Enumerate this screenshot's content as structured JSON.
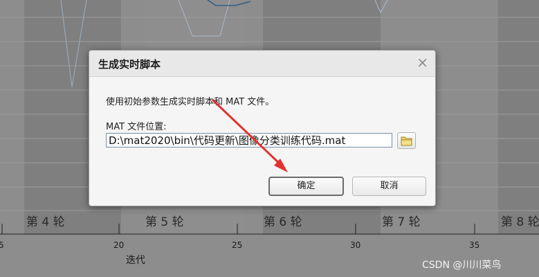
{
  "background_chart": {
    "epoch_labels": [
      "第 4 轮",
      "第 5 轮",
      "第 6 轮",
      "第 7 轮",
      "第 8 轮"
    ],
    "x_ticks": [
      "5",
      "20",
      "25",
      "30",
      "35"
    ],
    "x_label": "迭代"
  },
  "dialog": {
    "title": "生成实时脚本",
    "close_glyph": "×",
    "description": "使用初始参数生成实时脚本和 MAT 文件。",
    "location_label": "MAT 文件位置:",
    "location_value": "D:\\mat2020\\bin\\代码更新\\图像分类训练代码.mat",
    "browse_icon": "folder-icon",
    "ok_label": "确定",
    "cancel_label": "取消"
  },
  "watermark": "CSDN @川川菜鸟",
  "colors": {
    "annotation_arrow": "#e53030",
    "dialog_bg": "#f5f5f5",
    "dialog_header": "#e8e8e8"
  }
}
